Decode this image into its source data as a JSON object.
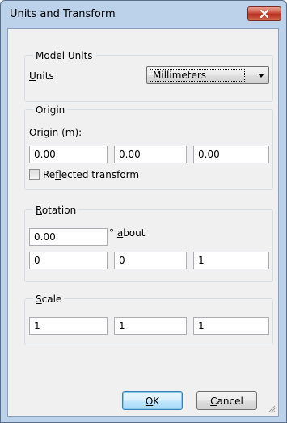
{
  "window": {
    "title": "Units and Transform"
  },
  "model_units": {
    "group_title": "Model Units",
    "units_label_first": "U",
    "units_label_rest": "nits",
    "units_value": "Millimeters"
  },
  "origin": {
    "group_title": "Origin",
    "origin_label_first": "O",
    "origin_label_rest": "rigin (m):",
    "values": [
      "0.00",
      "0.00",
      "0.00"
    ],
    "reflected_pre": "Re",
    "reflected_key": "f",
    "reflected_post": "lected transform",
    "reflected_checked": false
  },
  "rotation": {
    "group_title_first": "R",
    "group_title_rest": "otation",
    "angle": "0.00",
    "about_pre": "° ",
    "about_key": "a",
    "about_post": "bout",
    "axis": [
      "0",
      "0",
      "1"
    ]
  },
  "scale": {
    "group_title_first": "S",
    "group_title_rest": "cale",
    "values": [
      "1",
      "1",
      "1"
    ]
  },
  "buttons": {
    "ok_key": "O",
    "ok_rest": "K",
    "cancel_key": "C",
    "cancel_rest": "ancel"
  },
  "colors": {
    "frame": "#bcd1ea",
    "client": "#f0f0f0",
    "close_button": "#c9493a",
    "default_button_border": "#3c7fb1"
  }
}
